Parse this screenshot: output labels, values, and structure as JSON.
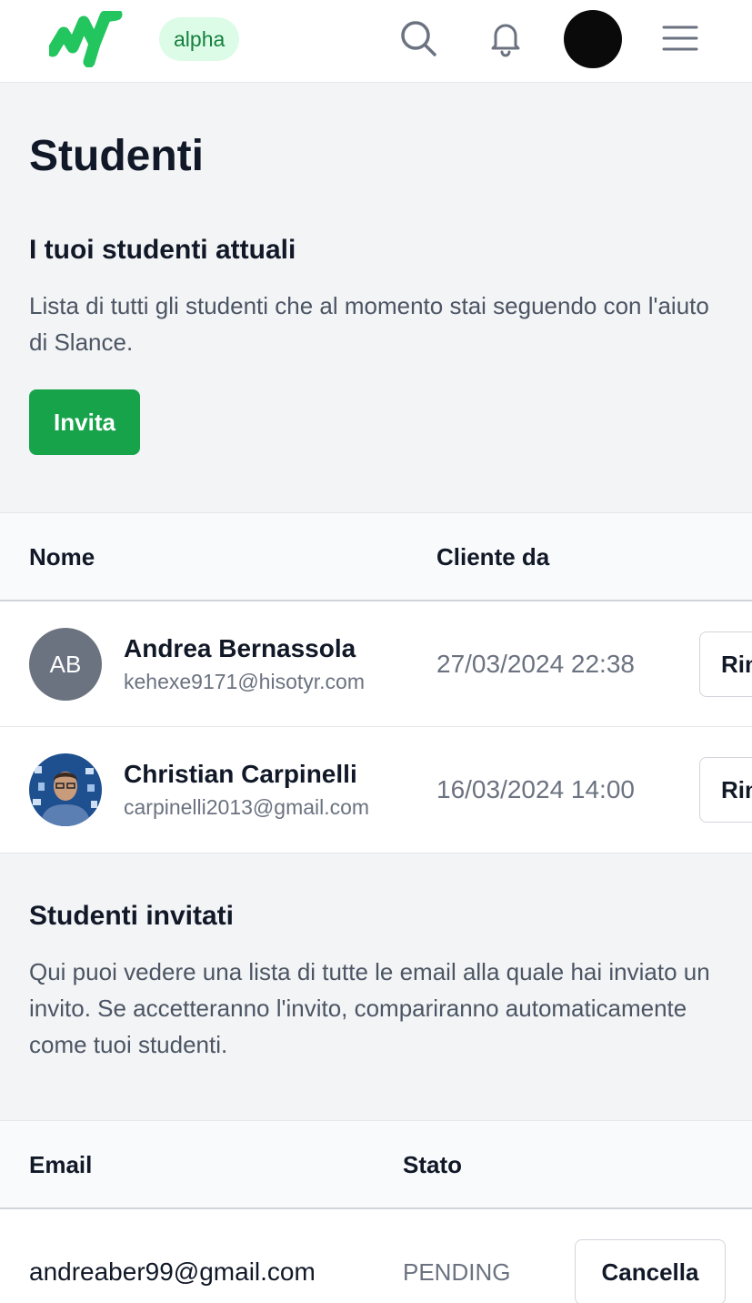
{
  "header": {
    "logo": "slance-logo",
    "badge": "alpha",
    "icons": [
      "search-icon",
      "bell-icon",
      "menu-icon"
    ],
    "brand_color": "#22c55e"
  },
  "page": {
    "title": "Studenti"
  },
  "current_students": {
    "title": "I tuoi studenti attuali",
    "description": "Lista di tutti gli studenti che al momento stai seguendo con l'aiuto di Slance.",
    "invite_label": "Invita",
    "columns": [
      "Nome",
      "Cliente da"
    ],
    "rows": [
      {
        "initials": "AB",
        "name": "Andrea Bernassola",
        "email": "kehexe9171@hisotyr.com",
        "client_since": "27/03/2024 22:38",
        "action": "Rimuovi"
      },
      {
        "initials": "",
        "name": "Christian Carpinelli",
        "email": "carpinelli2013@gmail.com",
        "client_since": "16/03/2024 14:00",
        "action": "Rimuovi"
      }
    ]
  },
  "invited_students": {
    "title": "Studenti invitati",
    "description": "Qui puoi vedere una lista di tutte le email alla quale hai inviato un invito. Se accetteranno l'invito, compariranno automaticamente come tuoi studenti.",
    "columns": [
      "Email",
      "Stato"
    ],
    "rows": [
      {
        "email": "andreaber99@gmail.com",
        "status": "PENDING",
        "action": "Cancella"
      }
    ]
  }
}
